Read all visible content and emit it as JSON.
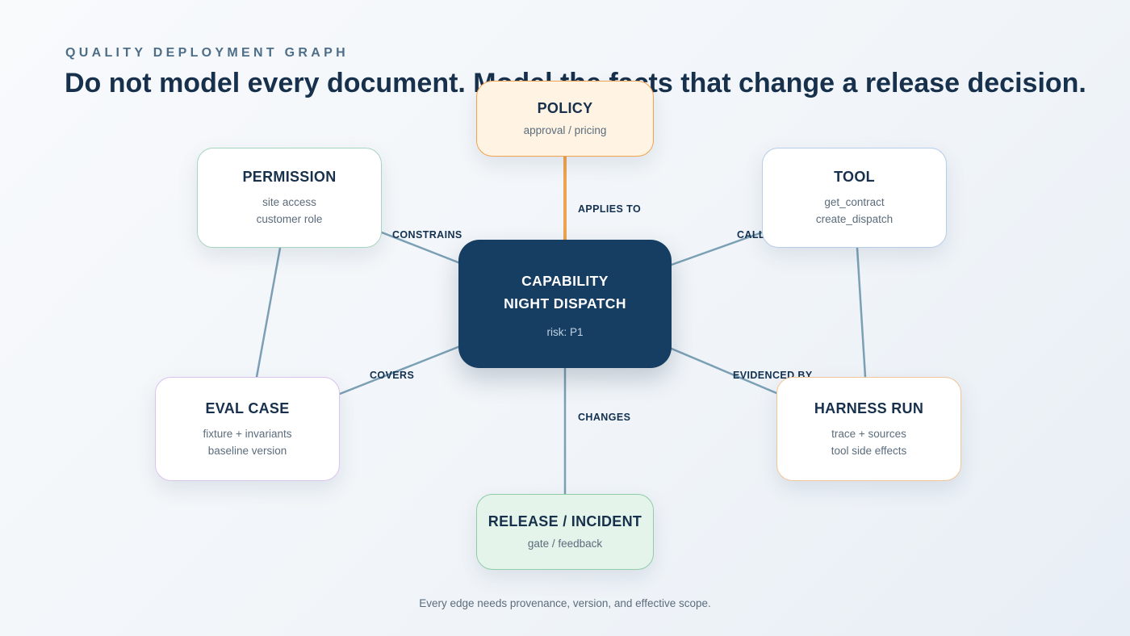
{
  "header": {
    "eyebrow": "QUALITY DEPLOYMENT GRAPH",
    "headline": "Do not model every document. Model the facts that change a release decision."
  },
  "nodes": {
    "capability": {
      "line1": "CAPABILITY",
      "line2": "NIGHT DISPATCH",
      "detail": "risk: P1"
    },
    "policy": {
      "title": "POLICY",
      "detail": "approval / pricing"
    },
    "permission": {
      "title": "PERMISSION",
      "details": [
        "site access",
        "customer role"
      ]
    },
    "tool": {
      "title": "TOOL",
      "details": [
        "get_contract",
        "create_dispatch"
      ]
    },
    "eval_case": {
      "title": "EVAL CASE",
      "details": [
        "fixture + invariants",
        "baseline version"
      ]
    },
    "harness_run": {
      "title": "HARNESS RUN",
      "details": [
        "trace + sources",
        "tool side effects"
      ]
    },
    "release_incident": {
      "title": "RELEASE / INCIDENT",
      "detail": "gate / feedback"
    }
  },
  "edges": {
    "applies_to": "APPLIES TO",
    "constrains": "CONSTRAINS",
    "calls": "CALLS",
    "covers": "COVERS",
    "evidenced_by": "EVIDENCED BY",
    "changes": "CHANGES"
  },
  "colors": {
    "center": "#163d62",
    "policy_accent": "#f0a24e",
    "release_accent": "#8fcca8",
    "edge": "#7b9fb5"
  },
  "footer": {
    "note": "Every edge needs provenance, version, and effective scope."
  }
}
